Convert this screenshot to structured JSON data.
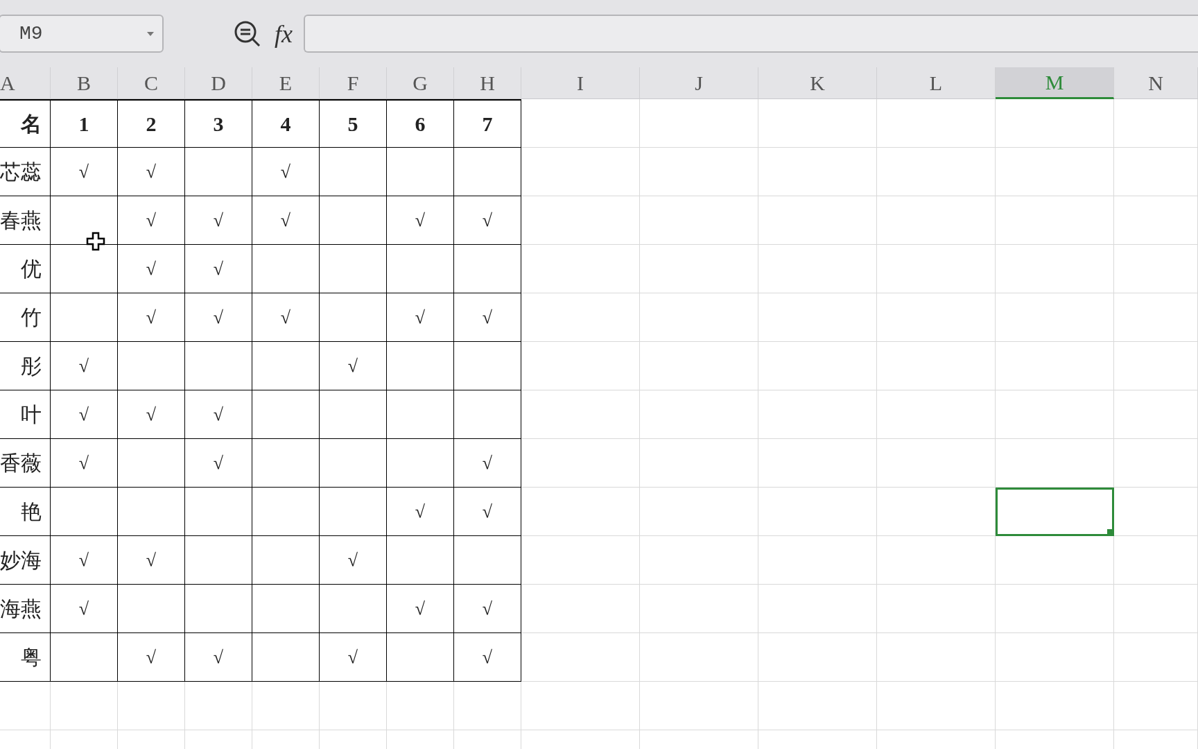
{
  "name_box": {
    "value": "M9"
  },
  "function_label": "fx",
  "columns": [
    {
      "label": "A",
      "selected": false
    },
    {
      "label": "B",
      "selected": false
    },
    {
      "label": "C",
      "selected": false
    },
    {
      "label": "D",
      "selected": false
    },
    {
      "label": "E",
      "selected": false
    },
    {
      "label": "F",
      "selected": false
    },
    {
      "label": "G",
      "selected": false
    },
    {
      "label": "H",
      "selected": false
    },
    {
      "label": "I",
      "selected": false
    },
    {
      "label": "J",
      "selected": false
    },
    {
      "label": "K",
      "selected": false
    },
    {
      "label": "L",
      "selected": false
    },
    {
      "label": "M",
      "selected": true
    },
    {
      "label": "N",
      "selected": false
    }
  ],
  "rows": [
    {
      "kind": "header",
      "name": "名",
      "cells": [
        "1",
        "2",
        "3",
        "4",
        "5",
        "6",
        "7"
      ],
      "selected": false
    },
    {
      "kind": "data",
      "name": "芯蕊",
      "cells": [
        "√",
        "√",
        null,
        "√",
        null,
        null,
        null
      ],
      "selected": false
    },
    {
      "kind": "data",
      "name": "春燕",
      "cells": [
        null,
        "√",
        "√",
        "√",
        null,
        "√",
        "√"
      ],
      "selected": false
    },
    {
      "kind": "data",
      "name": "优",
      "cells": [
        null,
        "√",
        "√",
        null,
        null,
        null,
        null
      ],
      "selected": false
    },
    {
      "kind": "data",
      "name": "竹",
      "cells": [
        null,
        "√",
        "√",
        "√",
        null,
        "√",
        "√"
      ],
      "selected": false
    },
    {
      "kind": "data",
      "name": "彤",
      "cells": [
        "√",
        null,
        null,
        null,
        "√",
        null,
        null
      ],
      "selected": false
    },
    {
      "kind": "data",
      "name": "叶",
      "cells": [
        "√",
        "√",
        "√",
        null,
        null,
        null,
        null
      ],
      "selected": false
    },
    {
      "kind": "data",
      "name": "香薇",
      "cells": [
        "√",
        null,
        "√",
        null,
        null,
        null,
        "√"
      ],
      "selected": false
    },
    {
      "kind": "data",
      "name": "艳",
      "cells": [
        null,
        null,
        null,
        null,
        null,
        "√",
        "√"
      ],
      "selected": true
    },
    {
      "kind": "data",
      "name": "妙海",
      "cells": [
        "√",
        "√",
        null,
        null,
        "√",
        null,
        null
      ],
      "selected": false
    },
    {
      "kind": "data",
      "name": "海燕",
      "cells": [
        "√",
        null,
        null,
        null,
        null,
        "√",
        "√"
      ],
      "selected": false
    },
    {
      "kind": "data",
      "name": "粤",
      "cells": [
        null,
        "√",
        "√",
        null,
        "√",
        null,
        "√"
      ],
      "selected": false
    }
  ]
}
